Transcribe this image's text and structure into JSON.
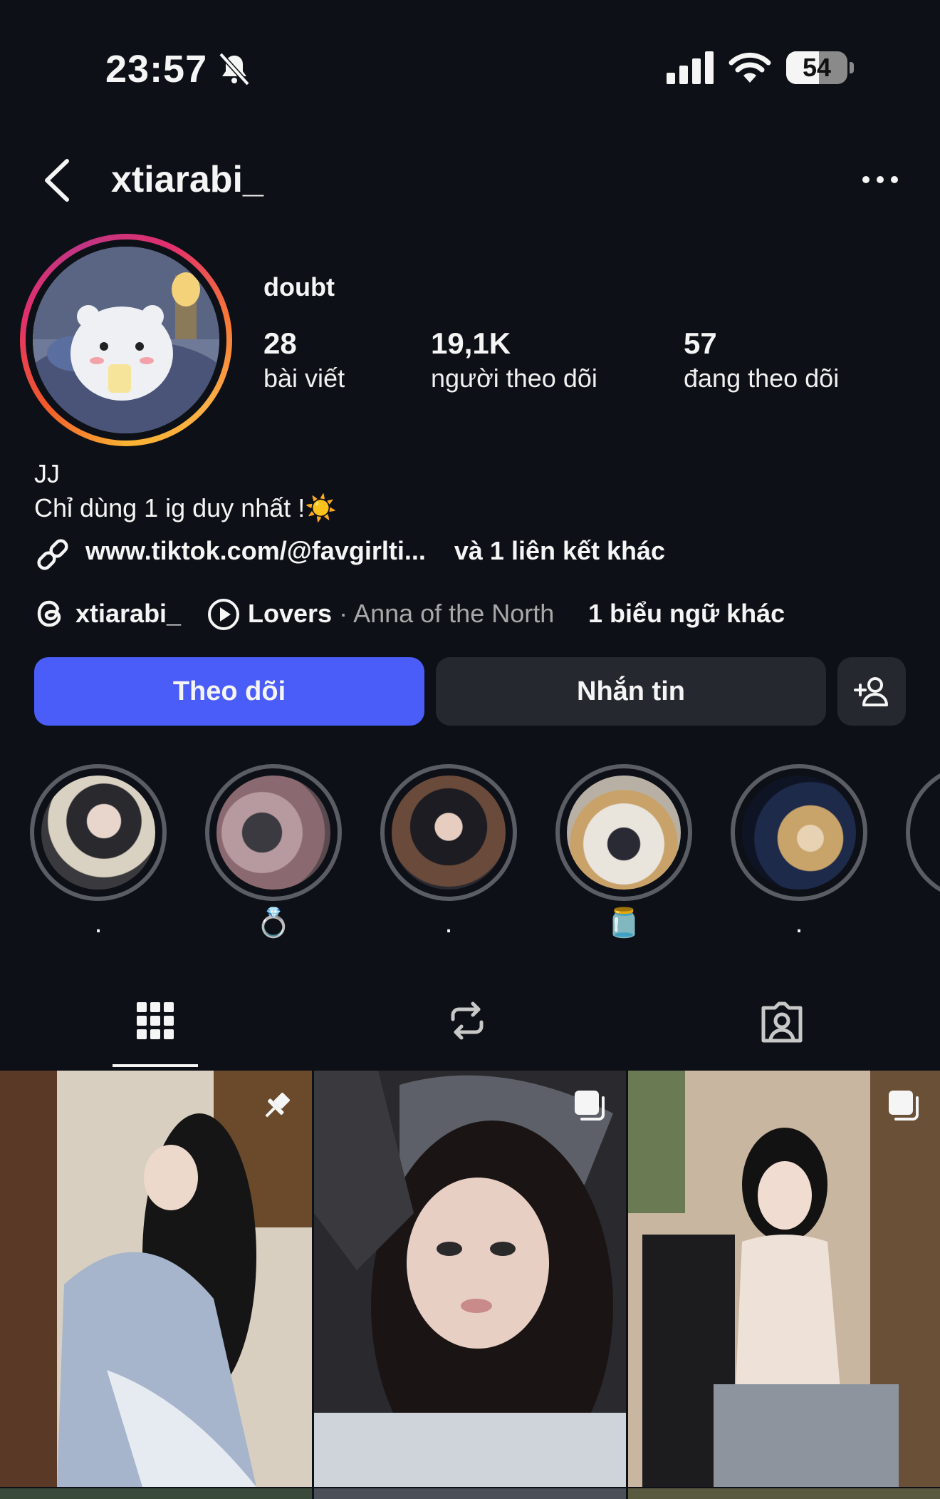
{
  "status_bar": {
    "time": "23:57",
    "battery": "54",
    "battery_level": 0.54
  },
  "nav": {
    "username": "xtiarabi_"
  },
  "profile": {
    "display_name": "doubt",
    "stats": [
      {
        "number": "28",
        "label": "bài viết"
      },
      {
        "number": "19,1K",
        "label": "người theo dõi"
      },
      {
        "number": "57",
        "label": "đang theo dõi"
      }
    ],
    "bio_line1": "JJ",
    "bio_line2": "Chỉ dùng 1 ig duy nhất !☀️",
    "link": "www.tiktok.com/@favgirlti...",
    "link_more": "và 1 liên kết khác",
    "threads_handle": "xtiarabi_",
    "music_title": "Lovers",
    "music_sep": " · ",
    "music_artist": "Anna of the North",
    "banner_more": "1 biểu ngữ khác"
  },
  "buttons": {
    "follow": "Theo dõi",
    "message": "Nhắn tin"
  },
  "highlights": [
    {
      "label": "."
    },
    {
      "label": "💍"
    },
    {
      "label": "."
    },
    {
      "label": "🫙"
    },
    {
      "label": "."
    }
  ],
  "tabs": [
    "grid-icon",
    "reels-icon",
    "tagged-icon"
  ],
  "colors": {
    "background": "#0d1016",
    "follow_button": "#4a5df9",
    "secondary_button": "#25282e"
  }
}
